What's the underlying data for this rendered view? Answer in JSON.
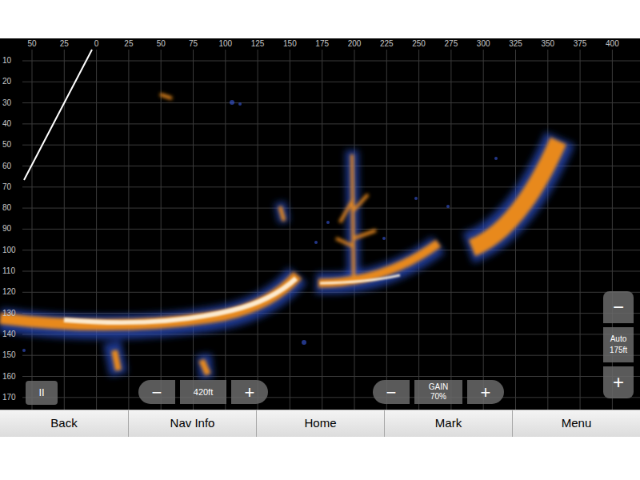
{
  "x_axis": {
    "ticks": [
      "50",
      "25",
      "0",
      "25",
      "50",
      "75",
      "100",
      "125",
      "150",
      "175",
      "200",
      "225",
      "250",
      "275",
      "300",
      "325",
      "350",
      "375",
      "400"
    ]
  },
  "y_axis": {
    "ticks": [
      "10",
      "20",
      "30",
      "40",
      "50",
      "60",
      "70",
      "80",
      "90",
      "100",
      "110",
      "120",
      "130",
      "140",
      "150",
      "160",
      "170"
    ]
  },
  "pause": "II",
  "range": {
    "minus": "−",
    "value": "420ft",
    "plus": "+"
  },
  "gain": {
    "minus": "−",
    "label": "GAIN",
    "value": "70%",
    "plus": "+"
  },
  "zoom": {
    "minus": "−",
    "mode": "Auto",
    "value": "175ft",
    "plus": "+"
  },
  "nav_buttons": [
    "Back",
    "Nav Info",
    "Home",
    "Mark",
    "Menu"
  ]
}
